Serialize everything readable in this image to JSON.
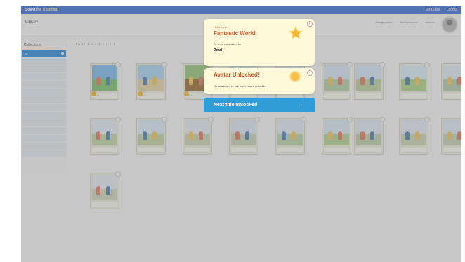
{
  "topbar": {
    "brand": "Storytime",
    "brand_sub": "Kids Hub",
    "links": [
      "My Class",
      "Logout"
    ]
  },
  "header": {
    "library": "Library",
    "links": [
      "Assignments",
      "Achievements",
      "Awards"
    ]
  },
  "sidebar": {
    "title": "Collections",
    "items": [
      "All",
      "",
      "",
      "",
      "",
      "",
      "",
      "",
      "",
      "",
      "",
      "",
      "",
      ""
    ]
  },
  "main": {
    "pager": "PART 1 2 3 4 5 6 7 8"
  },
  "books": [
    {
      "title": "Level 1",
      "color": "#7db9e6",
      "grass": "#7cc06a",
      "medal": true
    },
    {
      "title": "Level 2",
      "color": "#a8d2ef",
      "grass": "#e2cfa2",
      "medal": true
    },
    {
      "title": "Level 3",
      "color": "#94c37a",
      "grass": "#9c6a33",
      "medal": true
    },
    {
      "title": "",
      "color": "#cde3f5",
      "grass": "#a4c48a",
      "medal": false
    },
    {
      "title": "",
      "color": "#d7e6f1",
      "grass": "#c2cfa6",
      "medal": false
    },
    {
      "title": "",
      "color": "#cfe1f1",
      "grass": "#b0cda1",
      "medal": false
    },
    {
      "title": "",
      "color": "#cfe2f5",
      "grass": "#b7cd9b",
      "medal": false
    },
    {
      "title": "",
      "color": "#d6e8f3",
      "grass": "#a9cf86",
      "medal": false
    },
    {
      "title": "",
      "color": "#d9e6ef",
      "grass": "#afc7a5",
      "medal": false
    },
    {
      "title": "",
      "color": "#dde8f1",
      "grass": "#b9d2a0",
      "medal": false
    },
    {
      "title": "",
      "color": "#d5e5f2",
      "grass": "#bfcfa4",
      "medal": false
    },
    {
      "title": "",
      "color": "#e1e8f0",
      "grass": "#c6d0b1",
      "medal": false
    },
    {
      "title": "",
      "color": "#d7e2ee",
      "grass": "#c1cfb3",
      "medal": false
    },
    {
      "title": "",
      "color": "#dbe6ef",
      "grass": "#b6cfa6",
      "medal": false
    },
    {
      "title": "",
      "color": "#d3e3f1",
      "grass": "#afcf8f",
      "medal": false
    },
    {
      "title": "",
      "color": "#d9e5ef",
      "grass": "#b9cba6",
      "medal": false
    },
    {
      "title": "",
      "color": "#dee7ef",
      "grass": "#c5d2b4",
      "medal": false
    },
    {
      "title": "",
      "color": "#d9e3ee",
      "grass": "#c0cdb2",
      "medal": false
    },
    {
      "title": "",
      "color": "#e2e8ee",
      "grass": "#c9d1b9",
      "medal": false
    }
  ],
  "popup_complete": {
    "greeting": "Hello there,",
    "title": "Fantastic Work!",
    "line": "All work completed for",
    "name": "Pearl",
    "close": "×"
  },
  "popup_avatar": {
    "title": "Avatar Unlocked!",
    "line": "Go to avatars to see what you've unlocked.",
    "close": "×"
  },
  "next_button": {
    "label": "Next title unlocked",
    "arrow": "›"
  },
  "colors": {
    "topbar": "#3b6fd0",
    "accent": "#2f9ed8",
    "popup_bg": "#fff9d9",
    "popup_title": "#d9522a"
  }
}
